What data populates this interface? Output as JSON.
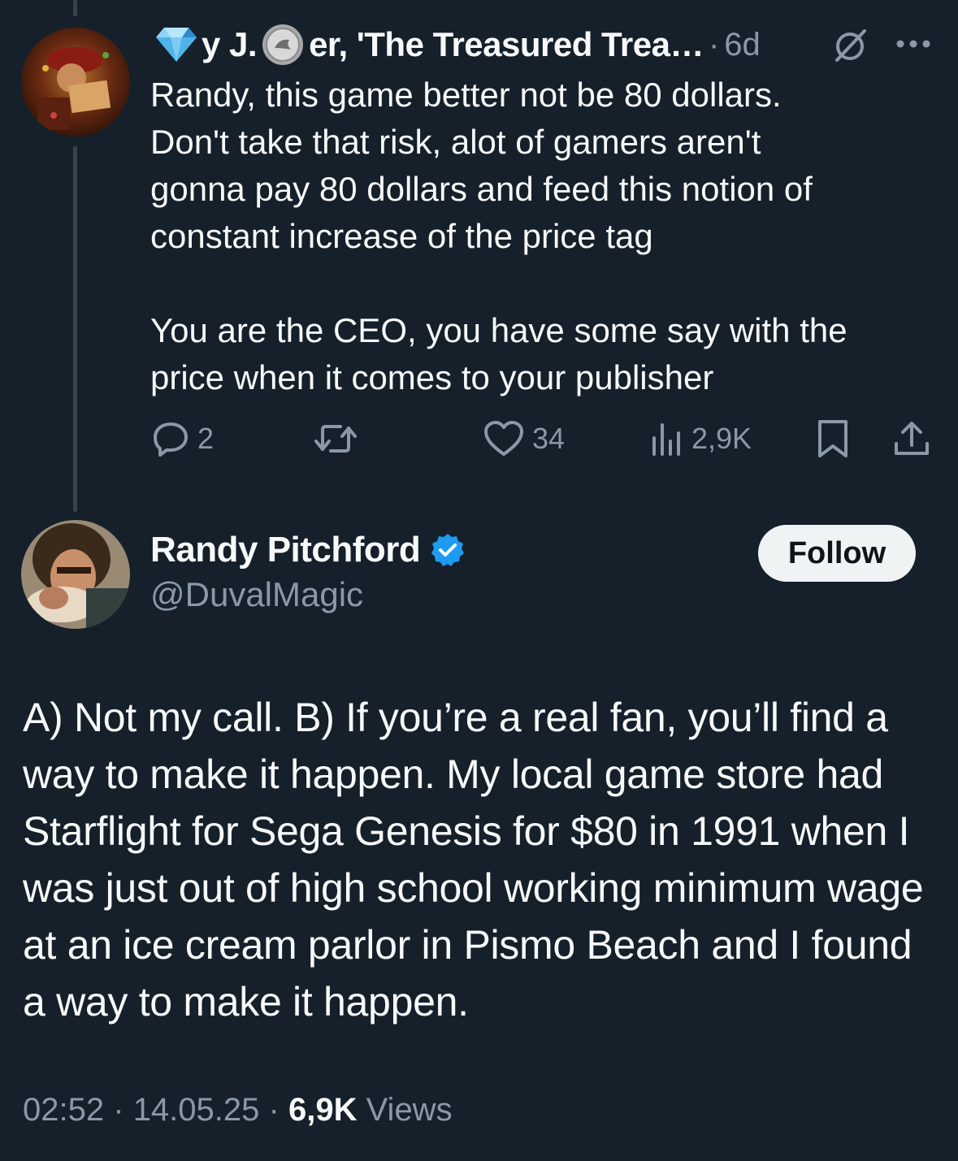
{
  "parent_tweet": {
    "name_prefix": "y J.",
    "name_suffix": "er, 'The Treasured Trea…",
    "time_separator": "·",
    "time": "6d",
    "text": "Randy, this game better not be 80 dollars.\nDon't take that risk, alot of gamers aren't\ngonna pay 80 dollars and feed this notion of\nconstant increase of the price tag\n\nYou are the CEO, you have some say with the\nprice when it comes to your publisher",
    "actions": {
      "replies": "2",
      "retweets": "",
      "likes": "34",
      "views": "2,9K"
    },
    "icons": [
      "diamond-icon",
      "coin-icon",
      "grok-icon",
      "more-icon",
      "reply-icon",
      "retweet-icon",
      "like-icon",
      "views-icon",
      "bookmark-icon",
      "share-icon"
    ]
  },
  "main_tweet": {
    "name": "Randy Pitchford",
    "handle": "@DuvalMagic",
    "follow_label": "Follow",
    "text": "A) Not my call. B) If you’re a real fan, you’ll find a way to make it happen. My local game store had Starflight for Sega Genesis for $80 in 1991 when I was just out of high school working minimum wage at an ice cream parlor in Pismo Beach and I found a way to make it happen.",
    "time": "02:52",
    "date": "14.05.25",
    "separator": "·",
    "views_count": "6,9K",
    "views_label": "Views"
  },
  "colors": {
    "background": "#15202b",
    "text": "#f7f9f9",
    "secondary": "#8b98a5",
    "verified": "#1d9bf0",
    "thread_line": "#38444d"
  }
}
